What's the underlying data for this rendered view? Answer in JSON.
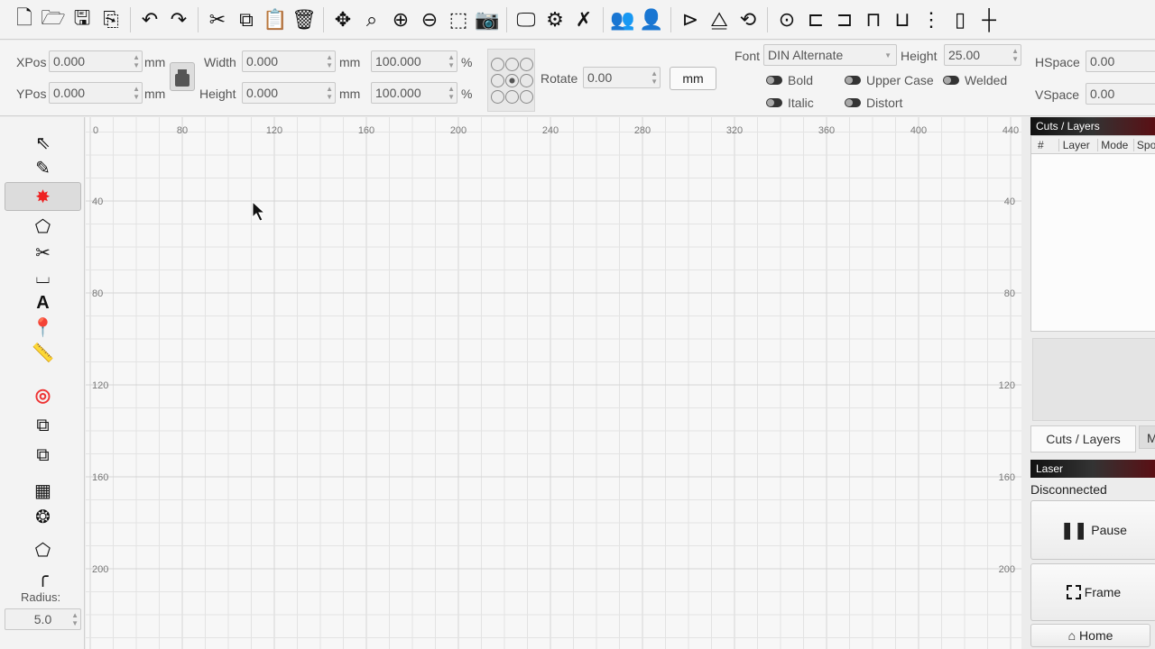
{
  "toolbar": {
    "icons": [
      "new-file",
      "open-folder",
      "save",
      "import",
      "undo",
      "redo",
      "cut",
      "copy",
      "paste",
      "delete",
      "move",
      "zoom-to-page",
      "zoom-in",
      "zoom-out",
      "frame-selection",
      "camera",
      "device-monitor",
      "settings",
      "tools",
      "group",
      "ungroup",
      "mirror-horizontal",
      "mirror-vertical",
      "rotate",
      "center",
      "align-left",
      "align-center",
      "align-top",
      "align-middle",
      "distribute",
      "measure",
      "snap"
    ]
  },
  "props": {
    "xpos_label": "XPos",
    "xpos": "0.000",
    "ypos_label": "YPos",
    "ypos": "0.000",
    "unit": "mm",
    "width_label": "Width",
    "width": "0.000",
    "height_label": "Height",
    "height": "0.000",
    "scale_w": "100.000",
    "scale_h": "100.000",
    "pct": "%",
    "rotate_label": "Rotate",
    "rotate": "0.00",
    "units_button": "mm",
    "font_label": "Font",
    "font": "DIN Alternate",
    "font_height_label": "Height",
    "font_height": "25.00",
    "bold": "Bold",
    "italic": "Italic",
    "upper_case": "Upper Case",
    "distort": "Distort",
    "welded": "Welded",
    "hspace_label": "HSpace",
    "hspace": "0.00",
    "vspace_label": "VSpace",
    "vspace": "0.00"
  },
  "left_tools": {
    "radius_label": "Radius:",
    "radius": "5.0"
  },
  "ruler": {
    "top": [
      "0",
      "80",
      "120",
      "160",
      "200",
      "240",
      "280",
      "320",
      "360",
      "400",
      "440"
    ],
    "left": [
      "40",
      "80",
      "120",
      "160",
      "200"
    ]
  },
  "right": {
    "cuts_title": "Cuts / Layers",
    "cols": [
      "#",
      "Layer",
      "Mode",
      "Spo"
    ],
    "tab1": "Cuts / Layers",
    "tab2": "M",
    "laser_title": "Laser",
    "status": "Disconnected",
    "pause": "Pause",
    "frame": "Frame",
    "home": "Home"
  }
}
